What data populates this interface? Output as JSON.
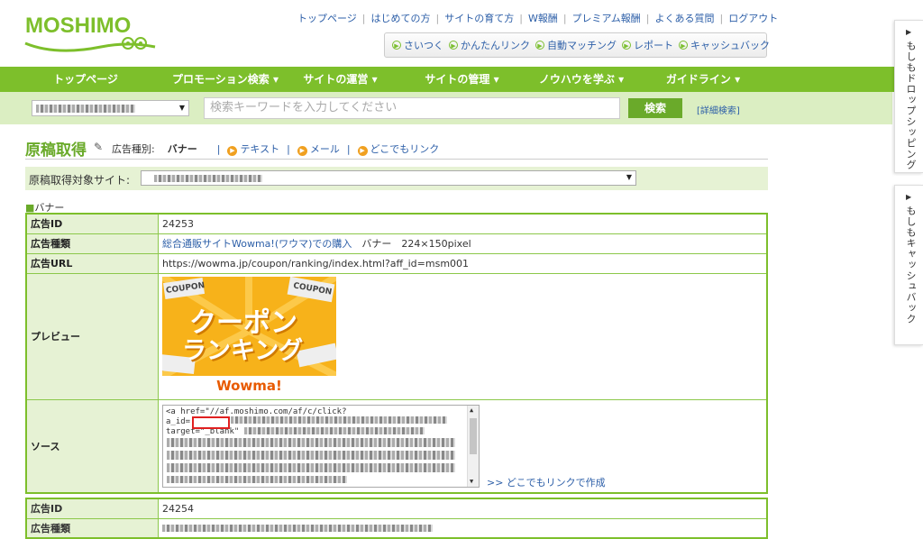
{
  "logo": {
    "text": "MOSHIMO"
  },
  "toplinks": [
    "トップページ",
    "はじめての方",
    "サイトの育て方",
    "W報酬",
    "プレミアム報酬",
    "よくある質問",
    "ログアウト"
  ],
  "quicklinks": [
    "さいつく",
    "かんたんリンク",
    "自動マッチング",
    "レポート",
    "キャッシュバック"
  ],
  "nav": [
    "トップページ",
    "プロモーション検索",
    "サイトの運営",
    "サイトの管理",
    "ノウハウを学ぶ",
    "ガイドライン"
  ],
  "search": {
    "placeholder": "検索キーワードを入力してください",
    "button": "検索",
    "detail": "[詳細検索]"
  },
  "page": {
    "title": "原稿取得",
    "adtype_label": "広告種別:",
    "adtype_current": "バナー",
    "adtype_links": [
      "テキスト",
      "メール",
      "どこでもリンク"
    ],
    "target_label": "原稿取得対象サイト:",
    "section": "バナー"
  },
  "table": {
    "labels": {
      "id": "広告ID",
      "type": "広告種類",
      "url": "広告URL",
      "preview": "プレビュー",
      "source": "ソース"
    },
    "id": "24253",
    "type_link": "総合通販サイトWowma!(ワウマ)での購入",
    "type_rest": "バナー　224×150pixel",
    "url": "https://wowma.jp/coupon/ranking/index.html?aff_id=msm001",
    "source_lines": [
      "<a href=\"//af.moshimo.com/af/c/click?",
      "a_id=",
      "target=\"_blank\""
    ],
    "dokodemo": ">> どこでもリンクで作成"
  },
  "banner": {
    "line1": "クーポン",
    "line2": "ランキング",
    "coupon": "COUPON",
    "brand": "Wowma!"
  },
  "table2": {
    "id_label": "広告ID",
    "id": "24254",
    "type_label": "広告種類"
  },
  "sidetabs": [
    "もしもドロップシッピング",
    "もしもキャッシュバック"
  ]
}
